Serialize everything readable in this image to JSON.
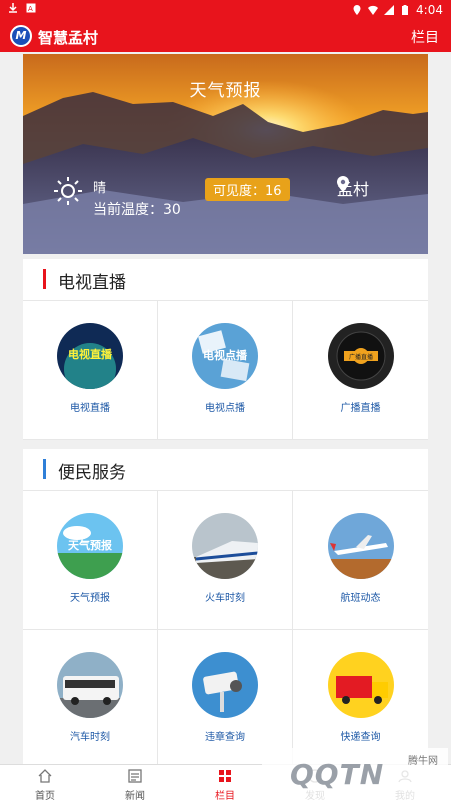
{
  "status_bar": {
    "time": "4:04"
  },
  "app_bar": {
    "logo_text": "M",
    "title": "智慧孟村",
    "menu_label": "栏目"
  },
  "banner": {
    "title": "天气预报",
    "weather": "晴",
    "temperature": "当前温度：30",
    "visibility": "可见度：16",
    "location": "孟村"
  },
  "tv_section": {
    "title": "电视直播",
    "accent": "#e8141c",
    "items": [
      {
        "label": "电视直播",
        "art_text": "电视直播"
      },
      {
        "label": "电视点播",
        "art_text": "电视点播"
      },
      {
        "label": "广播直播",
        "art_text": "广播直播"
      }
    ]
  },
  "service_section": {
    "title": "便民服务",
    "accent": "#2f7fd8",
    "items": [
      {
        "label": "天气预报",
        "art_text": "天气预报"
      },
      {
        "label": "火车时刻"
      },
      {
        "label": "航班动态"
      },
      {
        "label": "汽车时刻"
      },
      {
        "label": "违章查询"
      },
      {
        "label": "快递查询"
      }
    ]
  },
  "tab_bar": {
    "items": [
      {
        "label": "首页"
      },
      {
        "label": "新闻"
      },
      {
        "label": "栏目"
      },
      {
        "label": "发现"
      },
      {
        "label": "我的"
      }
    ]
  },
  "watermark": {
    "site": "QQTN",
    "text": "腾牛网"
  }
}
